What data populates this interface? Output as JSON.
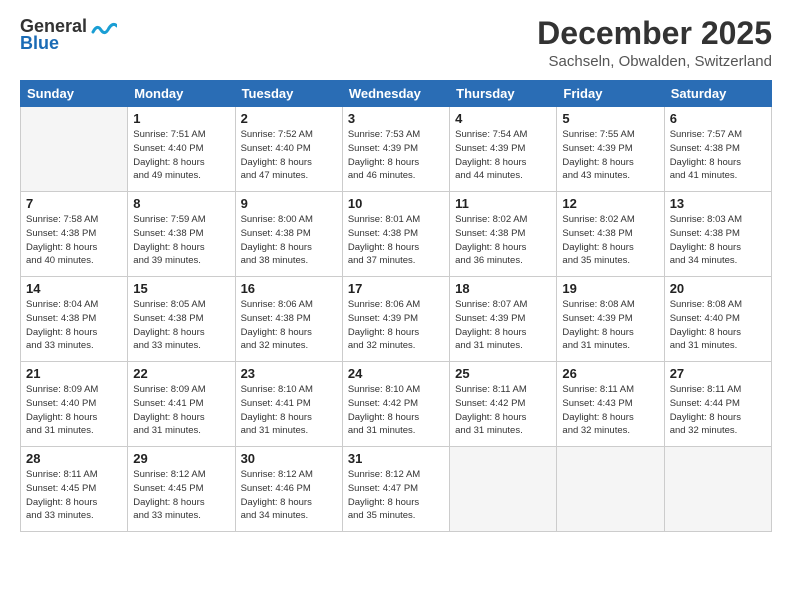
{
  "logo": {
    "line1": "General",
    "line2": "Blue",
    "wave": "〜"
  },
  "header": {
    "month": "December 2025",
    "location": "Sachseln, Obwalden, Switzerland"
  },
  "days_of_week": [
    "Sunday",
    "Monday",
    "Tuesday",
    "Wednesday",
    "Thursday",
    "Friday",
    "Saturday"
  ],
  "weeks": [
    [
      {
        "day": "",
        "content": ""
      },
      {
        "day": "1",
        "content": "Sunrise: 7:51 AM\nSunset: 4:40 PM\nDaylight: 8 hours\nand 49 minutes."
      },
      {
        "day": "2",
        "content": "Sunrise: 7:52 AM\nSunset: 4:40 PM\nDaylight: 8 hours\nand 47 minutes."
      },
      {
        "day": "3",
        "content": "Sunrise: 7:53 AM\nSunset: 4:39 PM\nDaylight: 8 hours\nand 46 minutes."
      },
      {
        "day": "4",
        "content": "Sunrise: 7:54 AM\nSunset: 4:39 PM\nDaylight: 8 hours\nand 44 minutes."
      },
      {
        "day": "5",
        "content": "Sunrise: 7:55 AM\nSunset: 4:39 PM\nDaylight: 8 hours\nand 43 minutes."
      },
      {
        "day": "6",
        "content": "Sunrise: 7:57 AM\nSunset: 4:38 PM\nDaylight: 8 hours\nand 41 minutes."
      }
    ],
    [
      {
        "day": "7",
        "content": "Sunrise: 7:58 AM\nSunset: 4:38 PM\nDaylight: 8 hours\nand 40 minutes."
      },
      {
        "day": "8",
        "content": "Sunrise: 7:59 AM\nSunset: 4:38 PM\nDaylight: 8 hours\nand 39 minutes."
      },
      {
        "day": "9",
        "content": "Sunrise: 8:00 AM\nSunset: 4:38 PM\nDaylight: 8 hours\nand 38 minutes."
      },
      {
        "day": "10",
        "content": "Sunrise: 8:01 AM\nSunset: 4:38 PM\nDaylight: 8 hours\nand 37 minutes."
      },
      {
        "day": "11",
        "content": "Sunrise: 8:02 AM\nSunset: 4:38 PM\nDaylight: 8 hours\nand 36 minutes."
      },
      {
        "day": "12",
        "content": "Sunrise: 8:02 AM\nSunset: 4:38 PM\nDaylight: 8 hours\nand 35 minutes."
      },
      {
        "day": "13",
        "content": "Sunrise: 8:03 AM\nSunset: 4:38 PM\nDaylight: 8 hours\nand 34 minutes."
      }
    ],
    [
      {
        "day": "14",
        "content": "Sunrise: 8:04 AM\nSunset: 4:38 PM\nDaylight: 8 hours\nand 33 minutes."
      },
      {
        "day": "15",
        "content": "Sunrise: 8:05 AM\nSunset: 4:38 PM\nDaylight: 8 hours\nand 33 minutes."
      },
      {
        "day": "16",
        "content": "Sunrise: 8:06 AM\nSunset: 4:38 PM\nDaylight: 8 hours\nand 32 minutes."
      },
      {
        "day": "17",
        "content": "Sunrise: 8:06 AM\nSunset: 4:39 PM\nDaylight: 8 hours\nand 32 minutes."
      },
      {
        "day": "18",
        "content": "Sunrise: 8:07 AM\nSunset: 4:39 PM\nDaylight: 8 hours\nand 31 minutes."
      },
      {
        "day": "19",
        "content": "Sunrise: 8:08 AM\nSunset: 4:39 PM\nDaylight: 8 hours\nand 31 minutes."
      },
      {
        "day": "20",
        "content": "Sunrise: 8:08 AM\nSunset: 4:40 PM\nDaylight: 8 hours\nand 31 minutes."
      }
    ],
    [
      {
        "day": "21",
        "content": "Sunrise: 8:09 AM\nSunset: 4:40 PM\nDaylight: 8 hours\nand 31 minutes."
      },
      {
        "day": "22",
        "content": "Sunrise: 8:09 AM\nSunset: 4:41 PM\nDaylight: 8 hours\nand 31 minutes."
      },
      {
        "day": "23",
        "content": "Sunrise: 8:10 AM\nSunset: 4:41 PM\nDaylight: 8 hours\nand 31 minutes."
      },
      {
        "day": "24",
        "content": "Sunrise: 8:10 AM\nSunset: 4:42 PM\nDaylight: 8 hours\nand 31 minutes."
      },
      {
        "day": "25",
        "content": "Sunrise: 8:11 AM\nSunset: 4:42 PM\nDaylight: 8 hours\nand 31 minutes."
      },
      {
        "day": "26",
        "content": "Sunrise: 8:11 AM\nSunset: 4:43 PM\nDaylight: 8 hours\nand 32 minutes."
      },
      {
        "day": "27",
        "content": "Sunrise: 8:11 AM\nSunset: 4:44 PM\nDaylight: 8 hours\nand 32 minutes."
      }
    ],
    [
      {
        "day": "28",
        "content": "Sunrise: 8:11 AM\nSunset: 4:45 PM\nDaylight: 8 hours\nand 33 minutes."
      },
      {
        "day": "29",
        "content": "Sunrise: 8:12 AM\nSunset: 4:45 PM\nDaylight: 8 hours\nand 33 minutes."
      },
      {
        "day": "30",
        "content": "Sunrise: 8:12 AM\nSunset: 4:46 PM\nDaylight: 8 hours\nand 34 minutes."
      },
      {
        "day": "31",
        "content": "Sunrise: 8:12 AM\nSunset: 4:47 PM\nDaylight: 8 hours\nand 35 minutes."
      },
      {
        "day": "",
        "content": ""
      },
      {
        "day": "",
        "content": ""
      },
      {
        "day": "",
        "content": ""
      }
    ]
  ]
}
